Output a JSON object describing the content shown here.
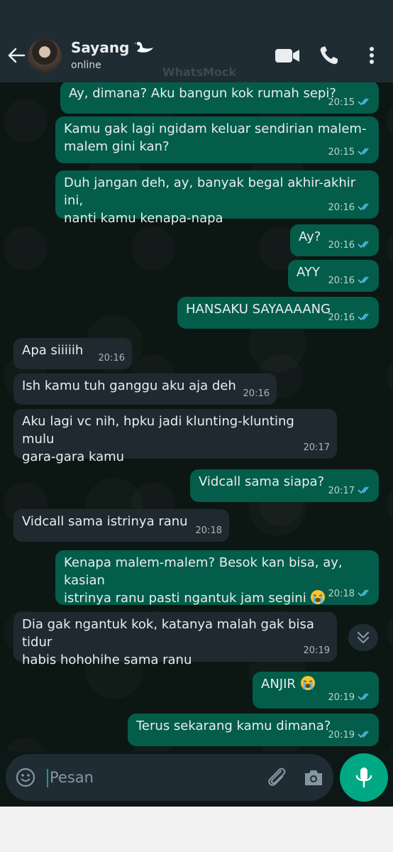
{
  "header": {
    "contact_name": "Sayang",
    "contact_name_emoji": "swan-emoji",
    "contact_status": "online",
    "watermark": "WhatsMock",
    "icons": [
      "back-arrow-icon",
      "video-call-icon",
      "phone-icon",
      "more-vert-icon"
    ]
  },
  "messages": [
    {
      "dir": "out",
      "text": "Ay, dimana? Aku bangun kok rumah sepi?",
      "time": "20:15",
      "status": "read"
    },
    {
      "dir": "out",
      "text": "Kamu gak lagi ngidam keluar sendirian malem-\nmalem gini kan?",
      "time": "20:15",
      "status": "read"
    },
    {
      "dir": "out",
      "text": "Duh jangan deh, ay, banyak begal akhir-akhir ini,\nnanti kamu kenapa-napa",
      "time": "20:16",
      "status": "read"
    },
    {
      "dir": "out",
      "text": "Ay?",
      "time": "20:16",
      "status": "read"
    },
    {
      "dir": "out",
      "text": "AYY",
      "time": "20:16",
      "status": "read"
    },
    {
      "dir": "out",
      "text": "HANSAKU SAYAAAANG",
      "time": "20:16",
      "status": "read"
    },
    {
      "dir": "in",
      "text": "Apa siiiiih",
      "time": "20:16"
    },
    {
      "dir": "in",
      "text": "Ish kamu tuh ganggu aku aja deh",
      "time": "20:16"
    },
    {
      "dir": "in",
      "text": "Aku lagi vc nih, hpku jadi klunting-klunting mulu\ngara-gara kamu",
      "time": "20:17"
    },
    {
      "dir": "out",
      "text": "Vidcall sama siapa?",
      "time": "20:17",
      "status": "read"
    },
    {
      "dir": "in",
      "text": "Vidcall sama istrinya ranu",
      "time": "20:18"
    },
    {
      "dir": "out",
      "text": "Kenapa malem-malem? Besok kan bisa, ay, kasian\nistrinya ranu pasti ngantuk jam segini",
      "emoji": "loudly-crying-face-emoji",
      "time": "20:18",
      "status": "read"
    },
    {
      "dir": "in",
      "text": "Dia gak ngantuk kok, katanya malah gak bisa tidur\nhabis hohohihe sama ranu",
      "time": "20:19"
    },
    {
      "dir": "out",
      "text": "ANJIR",
      "emoji": "loudly-crying-face-emoji",
      "time": "20:19",
      "status": "read"
    },
    {
      "dir": "out",
      "text": "Terus sekarang kamu dimana?",
      "time": "20:19",
      "status": "read"
    }
  ],
  "composer": {
    "placeholder": "Pesan",
    "icons": [
      "emoji-icon",
      "attach-icon",
      "camera-icon",
      "mic-icon"
    ]
  },
  "scroll_button_icon": "double-chevron-down-icon",
  "colors": {
    "header_bg": "#1f2c34",
    "chat_bg": "#0c1613",
    "outgoing_bubble": "#035d4a",
    "incoming_bubble": "#1f2a30",
    "accent": "#00a884",
    "read_ticks": "#53bdeb"
  }
}
